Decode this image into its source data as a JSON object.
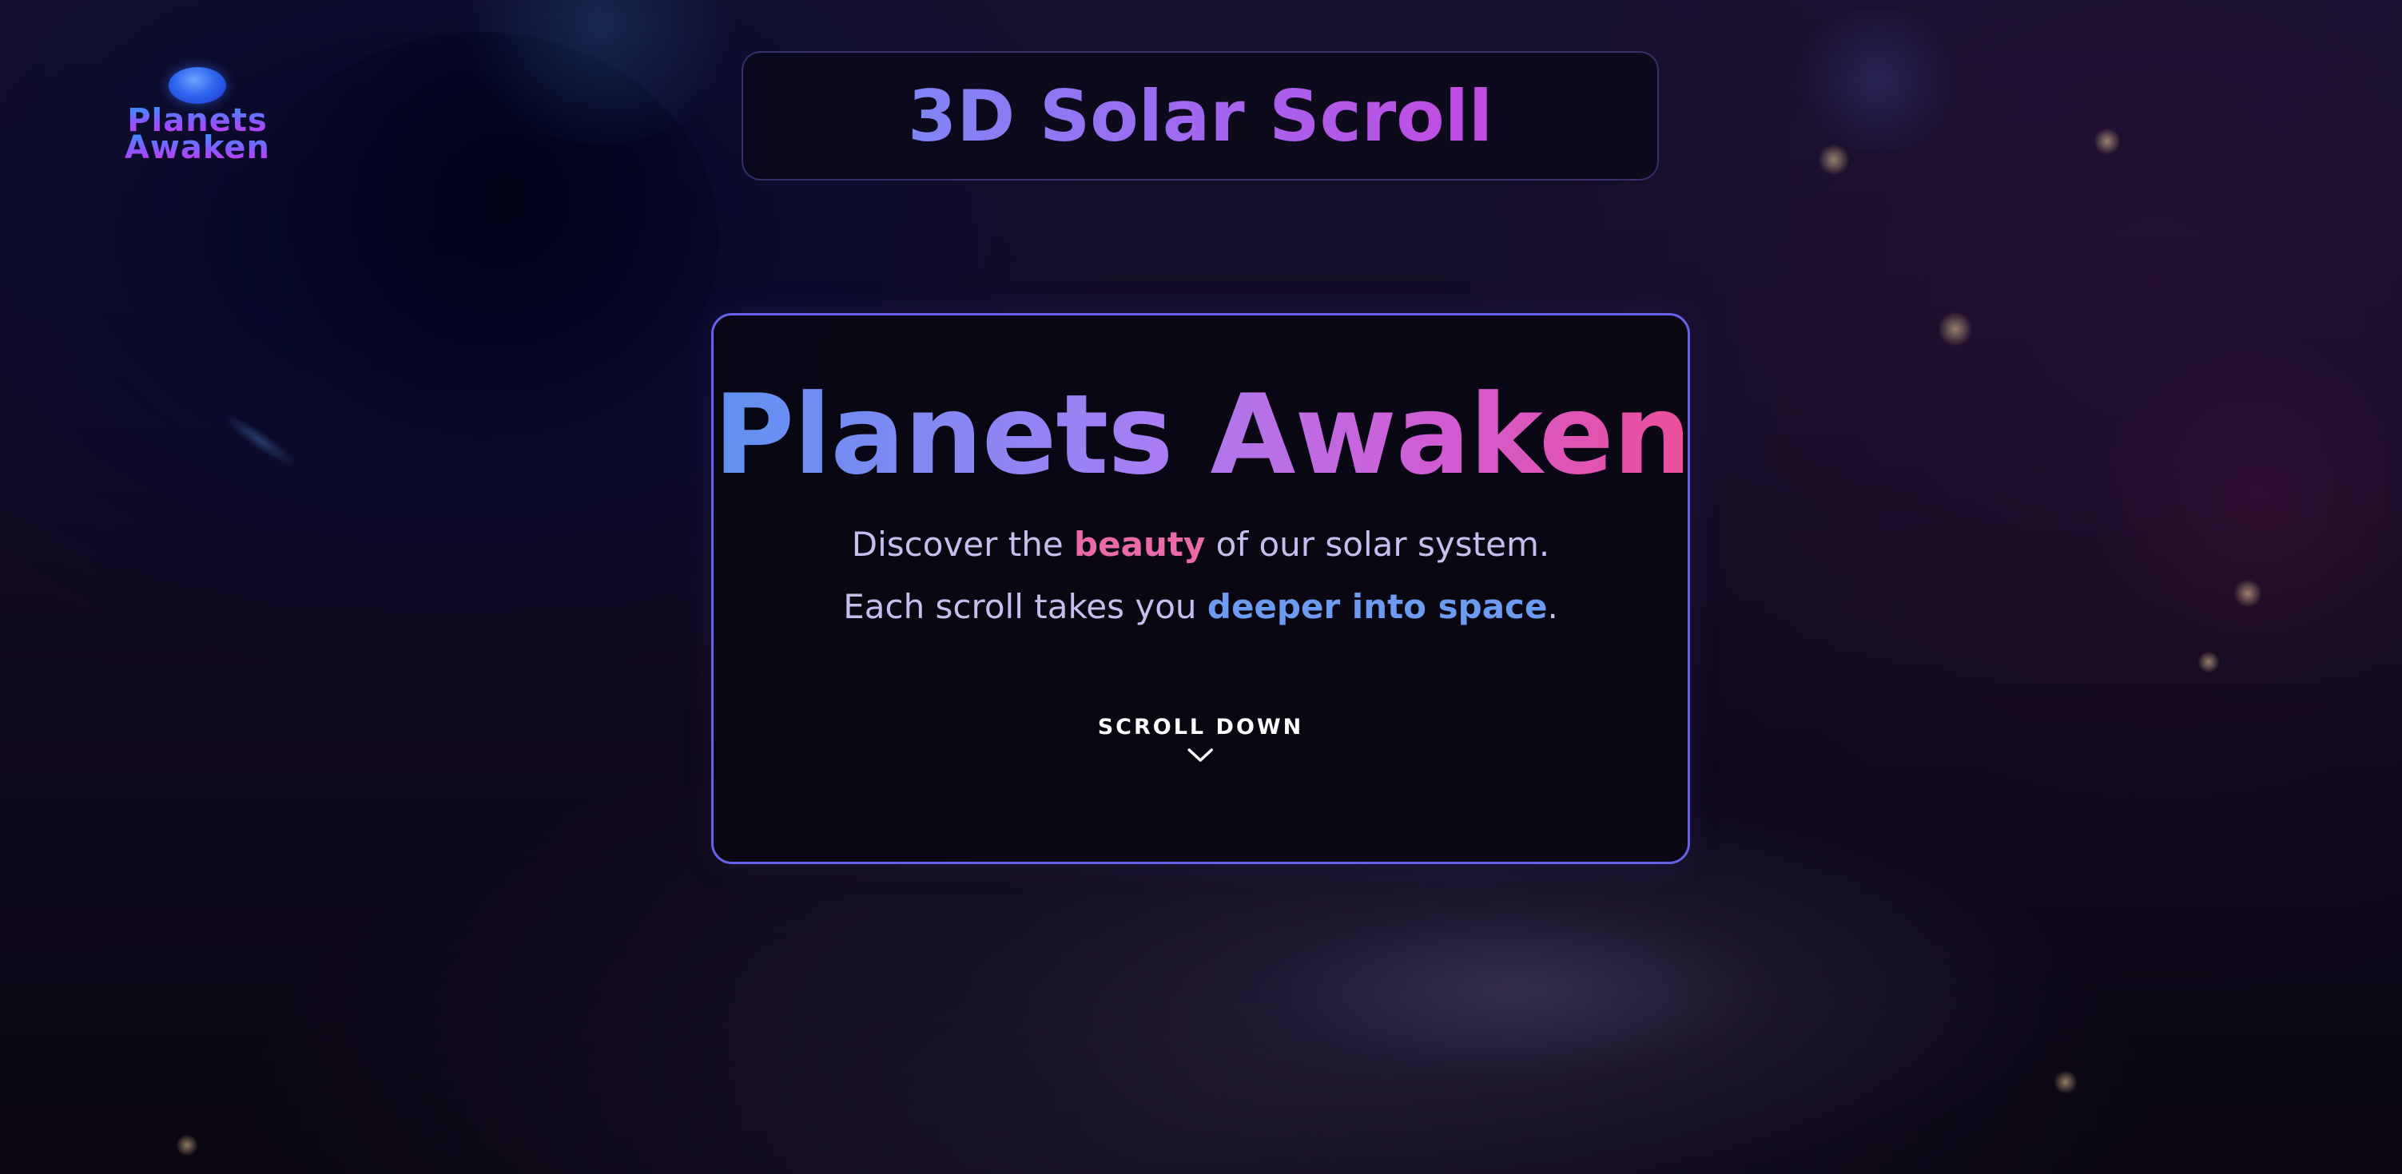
{
  "logo": {
    "line1": "Planets",
    "line2": "Awaken",
    "icon": "planet-icon"
  },
  "header": {
    "title": "3D Solar Scroll"
  },
  "hero": {
    "title": "Planets Awaken",
    "line1_pre": "Discover the ",
    "line1_accent": "beauty",
    "line1_post": " of our solar system.",
    "line2_pre": "Each scroll takes you ",
    "line2_accent": "deeper into space",
    "line2_post": ".",
    "scroll_label": "SCROLL DOWN",
    "scroll_icon": "chevron-down-icon"
  },
  "colors": {
    "card_border": "#6663ea",
    "accent_pink": "#ea6aa9",
    "accent_blue": "#6e9bf2",
    "body_text": "#c3c0ee",
    "logo_planet": "#2f66f0"
  }
}
